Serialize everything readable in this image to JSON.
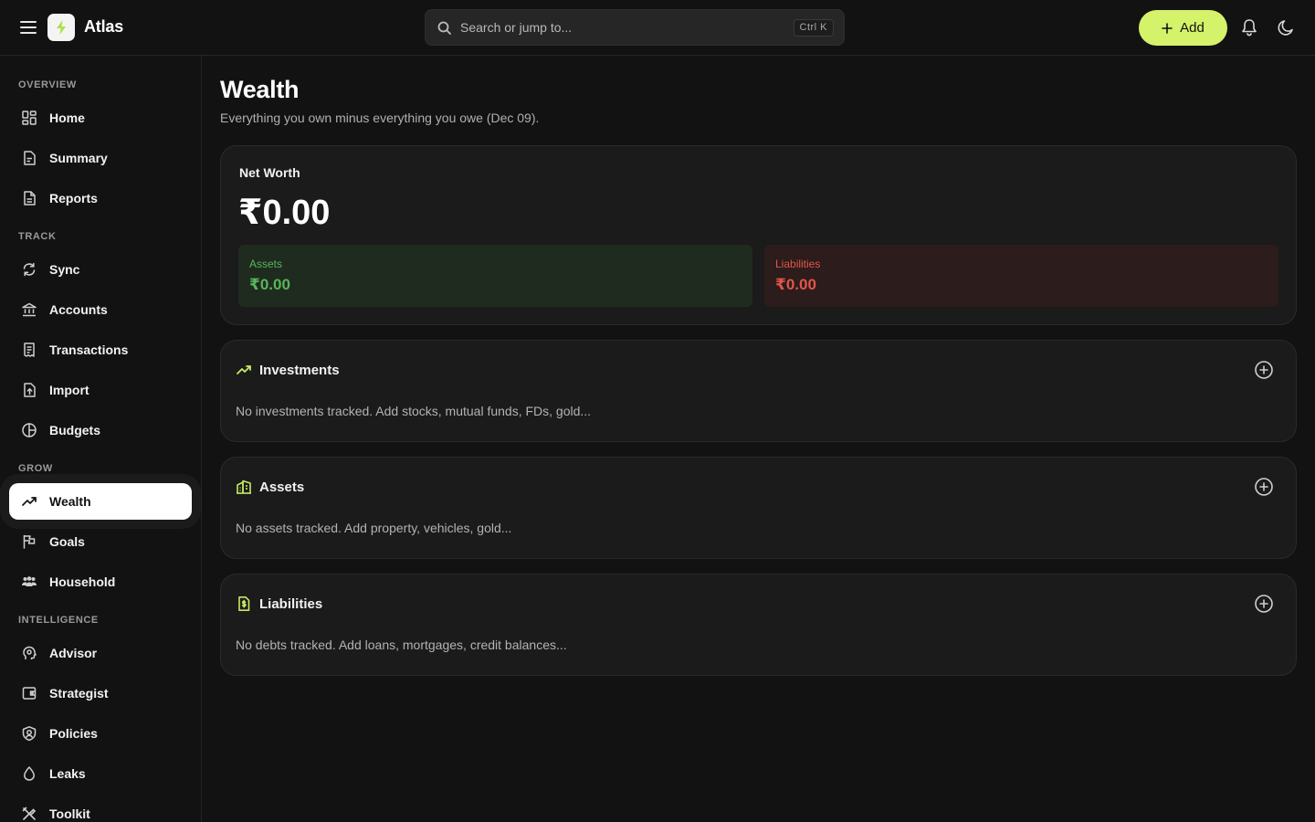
{
  "app": {
    "name": "Atlas"
  },
  "search": {
    "placeholder": "Search or jump to...",
    "shortcut": "Ctrl K"
  },
  "header": {
    "add_label": "Add"
  },
  "theme": {
    "accent": "#d4f26a",
    "assets_color": "#58b65a",
    "liabilities_color": "#e0564a"
  },
  "sidebar": {
    "sections": [
      {
        "label": "OVERVIEW",
        "items": [
          {
            "label": "Home",
            "icon": "dashboard-icon"
          },
          {
            "label": "Summary",
            "icon": "summary-icon"
          },
          {
            "label": "Reports",
            "icon": "document-icon"
          }
        ]
      },
      {
        "label": "TRACK",
        "items": [
          {
            "label": "Sync",
            "icon": "sync-icon"
          },
          {
            "label": "Accounts",
            "icon": "bank-icon"
          },
          {
            "label": "Transactions",
            "icon": "receipt-icon"
          },
          {
            "label": "Import",
            "icon": "file-upload-icon"
          },
          {
            "label": "Budgets",
            "icon": "pie-chart-icon"
          }
        ]
      },
      {
        "label": "GROW",
        "items": [
          {
            "label": "Wealth",
            "icon": "trending-up-icon",
            "active": true
          },
          {
            "label": "Goals",
            "icon": "flag-icon"
          },
          {
            "label": "Household",
            "icon": "people-icon"
          }
        ]
      },
      {
        "label": "INTELLIGENCE",
        "items": [
          {
            "label": "Advisor",
            "icon": "brain-icon"
          },
          {
            "label": "Strategist",
            "icon": "wallet-icon"
          },
          {
            "label": "Policies",
            "icon": "shield-icon"
          },
          {
            "label": "Leaks",
            "icon": "drop-icon"
          },
          {
            "label": "Toolkit",
            "icon": "tools-icon"
          }
        ]
      }
    ]
  },
  "page": {
    "title": "Wealth",
    "subtitle": "Everything you own minus everything you owe (Dec 09)."
  },
  "net_worth": {
    "label": "Net Worth",
    "value": "₹0.00",
    "assets": {
      "label": "Assets",
      "value": "₹0.00"
    },
    "liabilities": {
      "label": "Liabilities",
      "value": "₹0.00"
    }
  },
  "sections": {
    "investments": {
      "title": "Investments",
      "icon": "trending-up-icon",
      "empty": "No investments tracked. Add stocks, mutual funds, FDs, gold..."
    },
    "assets": {
      "title": "Assets",
      "icon": "buildings-icon",
      "empty": "No assets tracked. Add property, vehicles, gold..."
    },
    "liabilities": {
      "title": "Liabilities",
      "icon": "bill-icon",
      "empty": "No debts tracked. Add loans, mortgages, credit balances..."
    }
  }
}
